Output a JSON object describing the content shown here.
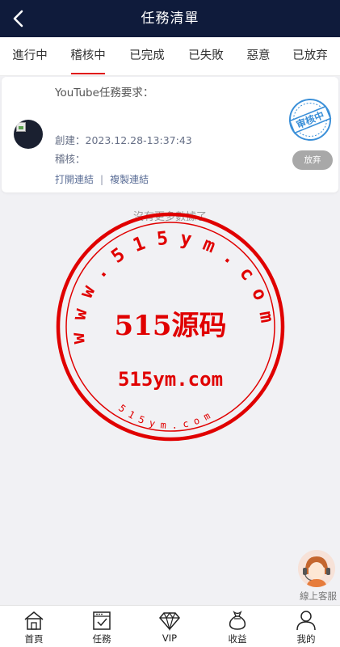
{
  "header": {
    "title": "任務清單"
  },
  "tabs": [
    {
      "label": "進行中"
    },
    {
      "label": "稽核中"
    },
    {
      "label": "已完成"
    },
    {
      "label": "已失敗"
    },
    {
      "label": "惡意"
    },
    {
      "label": "已放弃"
    }
  ],
  "active_tab": "稽核中",
  "task": {
    "requirement": "YouTube任務要求：",
    "created": "創建：2023.12.28-13:37:43",
    "audit": "稽核：",
    "open_link": "打開連結",
    "separator": "|",
    "copy_link": "複製連結",
    "stamp_text": "审核中",
    "abandon_label": "放弃"
  },
  "no_more": "沒有更多數據了",
  "watermark": {
    "arc_text": "w w w . 5 1 5 y m . c o m",
    "center_text": "515源码",
    "domain_text": "515ym.com",
    "bottom_text": "5 1 5 y m . c o m"
  },
  "service": {
    "label": "線上客服"
  },
  "bottom_nav": [
    {
      "label": "首頁",
      "icon": "home-icon"
    },
    {
      "label": "任務",
      "icon": "task-icon"
    },
    {
      "label": "VIP",
      "icon": "diamond-icon"
    },
    {
      "label": "收益",
      "icon": "money-bag-icon"
    },
    {
      "label": "我的",
      "icon": "user-icon"
    }
  ],
  "colors": {
    "header_bg": "#0f1b3b",
    "accent": "#e01010",
    "stamp_blue": "#3a8fd8",
    "watermark_red": "#e00000"
  }
}
